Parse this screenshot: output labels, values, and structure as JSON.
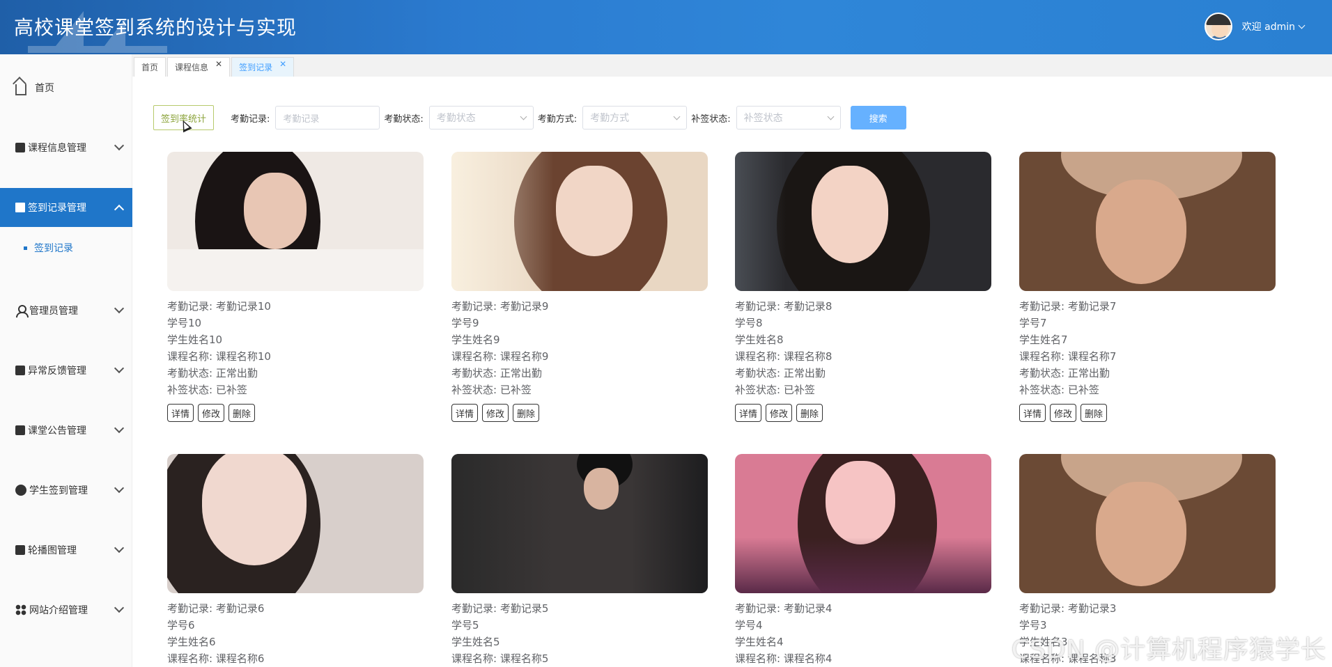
{
  "header": {
    "title": "高校课堂签到系统的设计与实现",
    "welcome": "欢迎 admin"
  },
  "sidebar": {
    "items": [
      {
        "label": "首页"
      },
      {
        "label": "课程信息管理"
      },
      {
        "label": "签到记录管理"
      },
      {
        "label": "管理员管理"
      },
      {
        "label": "异常反馈管理"
      },
      {
        "label": "课堂公告管理"
      },
      {
        "label": "学生签到管理"
      },
      {
        "label": "轮播图管理"
      },
      {
        "label": "网站介绍管理"
      }
    ],
    "sub_item": "签到记录"
  },
  "tabs": [
    {
      "label": "首页"
    },
    {
      "label": "课程信息"
    },
    {
      "label": "签到记录"
    }
  ],
  "search": {
    "stat_button": "签到率统计",
    "record_label": "考勤记录:",
    "record_placeholder": "考勤记录",
    "status_label": "考勤状态:",
    "status_placeholder": "考勤状态",
    "method_label": "考勤方式:",
    "method_placeholder": "考勤方式",
    "makeup_label": "补签状态:",
    "makeup_placeholder": "补签状态",
    "search_button": "搜索"
  },
  "card_labels": {
    "record": "考勤记录:",
    "course": "课程名称:",
    "status": "考勤状态:",
    "makeup": "补签状态:",
    "detail": "详情",
    "edit": "修改",
    "delete": "删除"
  },
  "cards": [
    {
      "record": "考勤记录10",
      "student_no": "学号10",
      "name": "学生姓名10",
      "course": "课程名称10",
      "status": "正常出勤",
      "makeup": "已补签"
    },
    {
      "record": "考勤记录9",
      "student_no": "学号9",
      "name": "学生姓名9",
      "course": "课程名称9",
      "status": "正常出勤",
      "makeup": "已补签"
    },
    {
      "record": "考勤记录8",
      "student_no": "学号8",
      "name": "学生姓名8",
      "course": "课程名称8",
      "status": "正常出勤",
      "makeup": "已补签"
    },
    {
      "record": "考勤记录7",
      "student_no": "学号7",
      "name": "学生姓名7",
      "course": "课程名称7",
      "status": "正常出勤",
      "makeup": "已补签"
    },
    {
      "record": "考勤记录6",
      "student_no": "学号6",
      "name": "学生姓名6",
      "course": "课程名称6"
    },
    {
      "record": "考勤记录5",
      "student_no": "学号5",
      "name": "学生姓名5",
      "course": "课程名称5"
    },
    {
      "record": "考勤记录4",
      "student_no": "学号4",
      "name": "学生姓名4",
      "course": "课程名称4"
    },
    {
      "record": "考勤记录3",
      "student_no": "学号3",
      "name": "学生姓名3",
      "course": "课程名称3"
    }
  ],
  "watermark": "CSDN @计算机程序猿学长",
  "colors": {
    "header": "#2b7bd0",
    "active_menu": "#1f76c9",
    "search_button": "#66b1ff"
  }
}
